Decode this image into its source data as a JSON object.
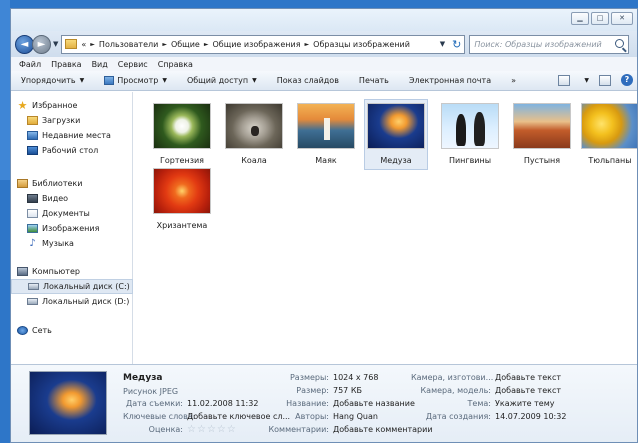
{
  "address": {
    "crumbs": [
      "Пользователи",
      "Общие",
      "Общие изображения",
      "Образцы изображений"
    ],
    "overflow": "«",
    "search_placeholder": "Поиск: Образцы изображений"
  },
  "menu": [
    "Файл",
    "Правка",
    "Вид",
    "Сервис",
    "Справка"
  ],
  "toolbar": {
    "organize": "Упорядочить",
    "preview": "Просмотр",
    "share": "Общий доступ",
    "slideshow": "Показ слайдов",
    "print": "Печать",
    "email": "Электронная почта",
    "more": "»"
  },
  "nav": {
    "favorites": {
      "label": "Избранное",
      "items": [
        "Загрузки",
        "Недавние места",
        "Рабочий стол"
      ]
    },
    "libraries": {
      "label": "Библиотеки",
      "items": [
        "Видео",
        "Документы",
        "Изображения",
        "Музыка"
      ]
    },
    "computer": {
      "label": "Компьютер",
      "items": [
        "Локальный диск (C:)",
        "Локальный диск (D:)"
      ]
    },
    "network": {
      "label": "Сеть"
    }
  },
  "files": [
    {
      "name": "Гортензия"
    },
    {
      "name": "Коала"
    },
    {
      "name": "Маяк"
    },
    {
      "name": "Медуза"
    },
    {
      "name": "Пингвины"
    },
    {
      "name": "Пустыня"
    },
    {
      "name": "Тюльпаны"
    },
    {
      "name": "Хризантема"
    }
  ],
  "details": {
    "name": "Медуза",
    "type": "Рисунок JPEG",
    "date_taken_label": "Дата съемки:",
    "date_taken": "11.02.2008 11:32",
    "tags_label": "Ключевые слова:",
    "tags": "Добавьте ключевое сл...",
    "rating_label": "Оценка:",
    "rating": 0,
    "dimensions_label": "Размеры:",
    "dimensions": "1024 x 768",
    "size_label": "Размер:",
    "size": "757 КБ",
    "title_label": "Название:",
    "title": "Добавьте название",
    "authors_label": "Авторы:",
    "authors": "Hang Quan",
    "comments_label": "Комментарии:",
    "comments": "Добавьте комментарии",
    "camera_maker_label": "Камера, изготови...",
    "camera_maker": "Добавьте текст",
    "camera_model_label": "Камера, модель:",
    "camera_model": "Добавьте текст",
    "subject_label": "Тема:",
    "subject": "Укажите тему",
    "date_created_label": "Дата создания:",
    "date_created": "14.07.2009 10:32"
  }
}
